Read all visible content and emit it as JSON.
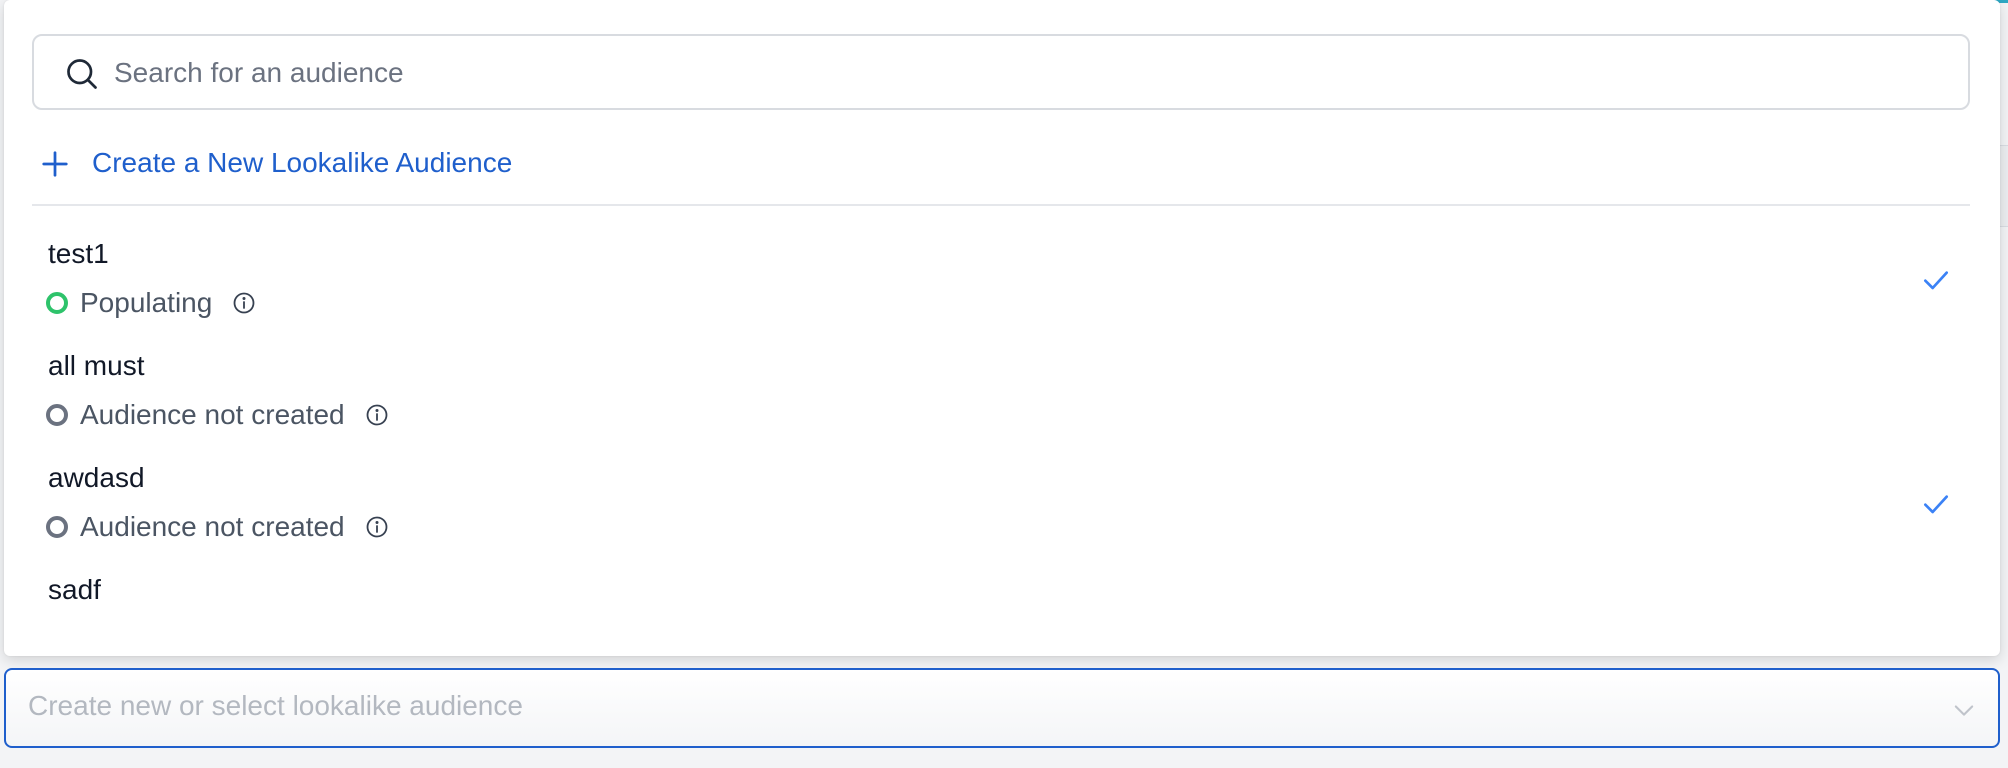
{
  "search": {
    "placeholder": "Search for an audience",
    "value": ""
  },
  "create_action": {
    "label": "Create a New Lookalike Audience"
  },
  "audiences": [
    {
      "name": "test1",
      "status": "Populating",
      "status_color": "#2ec36b",
      "selected": true
    },
    {
      "name": "all must",
      "status": "Audience not created",
      "status_color": "#6b7280",
      "selected": false
    },
    {
      "name": "awdasd",
      "status": "Audience not created",
      "status_color": "#6b7280",
      "selected": true
    },
    {
      "name": "sadf",
      "status": "",
      "status_color": "",
      "selected": false
    }
  ],
  "select": {
    "placeholder": "Create new or select lookalike audience"
  },
  "colors": {
    "accent": "#1f5fcc",
    "check": "#3b82f6",
    "populating": "#2ec36b",
    "not_created": "#6b7280"
  },
  "icons": {
    "search": "search-icon",
    "plus": "plus-icon",
    "info": "info-icon",
    "check": "check-icon",
    "chevron": "chevron-down-icon"
  }
}
